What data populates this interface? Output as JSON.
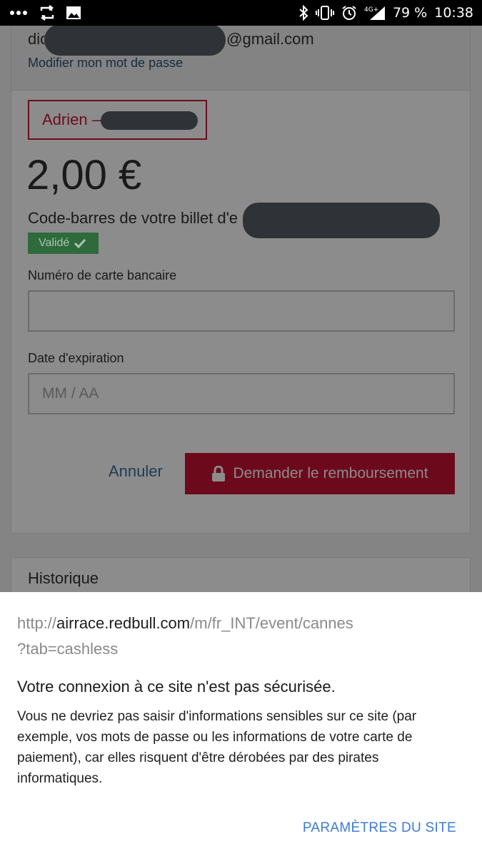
{
  "status_bar": {
    "battery": "79 %",
    "time": "10:38",
    "network": "4G+"
  },
  "account": {
    "email_prefix": "dic",
    "email_suffix": "@gmail.com",
    "change_password": "Modifier mon mot de passe"
  },
  "ticket": {
    "holder_name": "Adrien –",
    "amount": "2,00 €",
    "barcode_label": "Code-barres de votre billet d'e",
    "validated_badge": "Validé"
  },
  "form": {
    "card_number_label": "Numéro de carte bancaire",
    "card_number_value": "",
    "expiry_label": "Date d'expiration",
    "expiry_placeholder": "MM / AA",
    "cancel": "Annuler",
    "refund_button": "Demander le remboursement"
  },
  "history": {
    "title": "Historique"
  },
  "security_sheet": {
    "url_scheme": "http://",
    "url_host": "airrace.redbull.com",
    "url_path": "/m/fr_INT/event/cannes",
    "url_query": "?tab=cashless",
    "title": "Votre connexion à ce site n'est pas sécurisée.",
    "body": "Vous ne devriez pas saisir d'informations sensibles sur ce site (par exemple, vos mots de passe ou les informations de votre carte de paiement), car elles risquent d'être dérobées par des pirates informatiques.",
    "site_settings": "PARAMÈTRES DU SITE"
  },
  "colors": {
    "accent_red": "#c8102e",
    "link_blue": "#3e7bd1",
    "success_green": "#2f8f46"
  }
}
